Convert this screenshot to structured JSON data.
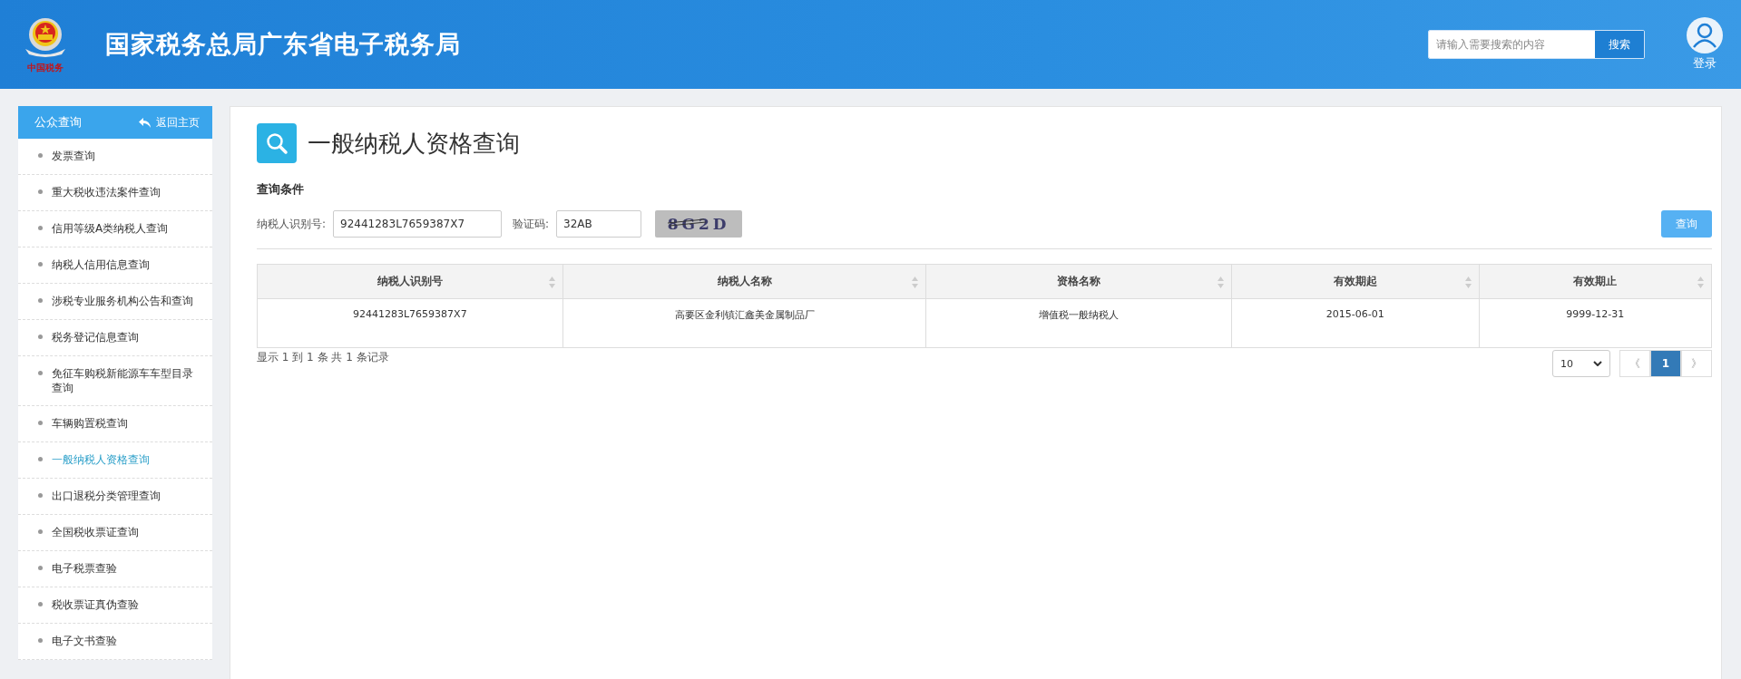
{
  "header": {
    "logo_caption": "中国税务",
    "title": "国家税务总局广东省电子税务局",
    "search": {
      "placeholder": "请输入需要搜索的内容",
      "button": "搜索"
    },
    "login": "登录"
  },
  "sidebar": {
    "title": "公众查询",
    "back": "返回主页",
    "items": [
      {
        "label": "发票查询",
        "selected": false
      },
      {
        "label": "重大税收违法案件查询",
        "selected": false
      },
      {
        "label": "信用等级A类纳税人查询",
        "selected": false
      },
      {
        "label": "纳税人信用信息查询",
        "selected": false
      },
      {
        "label": "涉税专业服务机构公告和查询",
        "selected": false
      },
      {
        "label": "税务登记信息查询",
        "selected": false
      },
      {
        "label": "免征车购税新能源车车型目录查询",
        "selected": false
      },
      {
        "label": "车辆购置税查询",
        "selected": false
      },
      {
        "label": "一般纳税人资格查询",
        "selected": true
      },
      {
        "label": "出口退税分类管理查询",
        "selected": false
      },
      {
        "label": "全国税收票证查询",
        "selected": false
      },
      {
        "label": "电子税票查验",
        "selected": false
      },
      {
        "label": "税收票证真伪查验",
        "selected": false
      },
      {
        "label": "电子文书查验",
        "selected": false
      }
    ]
  },
  "page": {
    "title": "一般纳税人资格查询",
    "section": "查询条件",
    "form": {
      "taxpayer_id_label": "纳税人识别号:",
      "taxpayer_id": "92441283L7659387X7",
      "captcha_label": "验证码:",
      "captcha_value": "32AB",
      "captcha_image": "8G2D",
      "submit": "查询"
    },
    "table": {
      "columns": [
        "纳税人识别号",
        "纳税人名称",
        "资格名称",
        "有效期起",
        "有效期止"
      ],
      "rows": [
        [
          "92441283L7659387X7",
          "高要区金利镇汇鑫美金属制品厂",
          "增值税一般纳税人",
          "2015-06-01",
          "9999-12-31"
        ]
      ]
    },
    "summary": "显示 1 到 1 条 共 1 条记录",
    "pagination": {
      "page_size": "10",
      "prev": "《",
      "next": "》",
      "pages": [
        {
          "label": "1",
          "selected": true
        }
      ]
    }
  }
}
